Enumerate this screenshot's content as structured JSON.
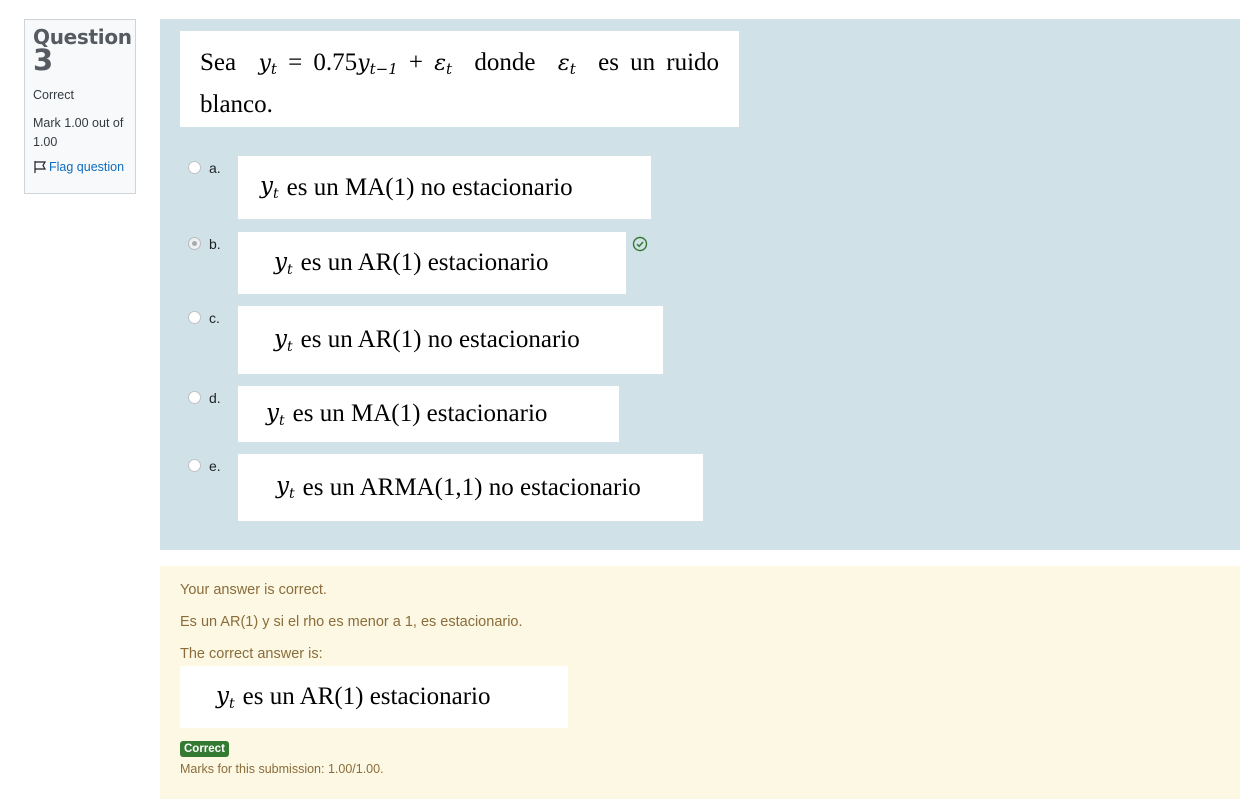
{
  "info": {
    "question_word": "Question",
    "question_number": "3",
    "state": "Correct",
    "grade": "Mark 1.00 out of 1.00",
    "flag_label": "Flag question"
  },
  "question": {
    "text_before": "Sea",
    "formula_main": "y",
    "formula_sub": "t",
    "formula_eq": "= 0.75",
    "formula_lag": "y",
    "formula_lag_sub": "t−1",
    "formula_plus": "+",
    "formula_eps": "ε",
    "formula_eps_sub": "t",
    "text_mid": "donde",
    "text_eps": "ε",
    "text_eps_sub": "t",
    "text_after": "es un ruido blanco."
  },
  "options": [
    {
      "letter": "a.",
      "var": "y",
      "sub": "t",
      "text": "es un MA(1) no estacionario",
      "checked": false
    },
    {
      "letter": "b.",
      "var": "y",
      "sub": "t",
      "text": "es un AR(1) estacionario",
      "checked": true
    },
    {
      "letter": "c.",
      "var": "y",
      "sub": "t",
      "text": "es un AR(1) no estacionario",
      "checked": false
    },
    {
      "letter": "d.",
      "var": "y",
      "sub": "t",
      "text": "es un MA(1) estacionario",
      "checked": false
    },
    {
      "letter": "e.",
      "var": "y",
      "sub": "t",
      "text": "es un ARMA(1,1) no estacionario",
      "checked": false
    }
  ],
  "feedback": {
    "result": "Your answer is correct.",
    "general": "Es un AR(1) y si el rho es menor a 1, es estacionario.",
    "right_answer_label": "The correct answer is:",
    "right_answer_var": "y",
    "right_answer_sub": "t",
    "right_answer_text": "es un AR(1) estacionario",
    "badge": "Correct",
    "marks": "Marks for this submission: 1.00/1.00."
  },
  "colors": {
    "formulation_bg": "#d0e2e7",
    "feedback_bg": "#fcf8e3",
    "feedback_text": "#8a6d3b",
    "badge_bg": "#357a32",
    "link": "#0f6cbf"
  }
}
